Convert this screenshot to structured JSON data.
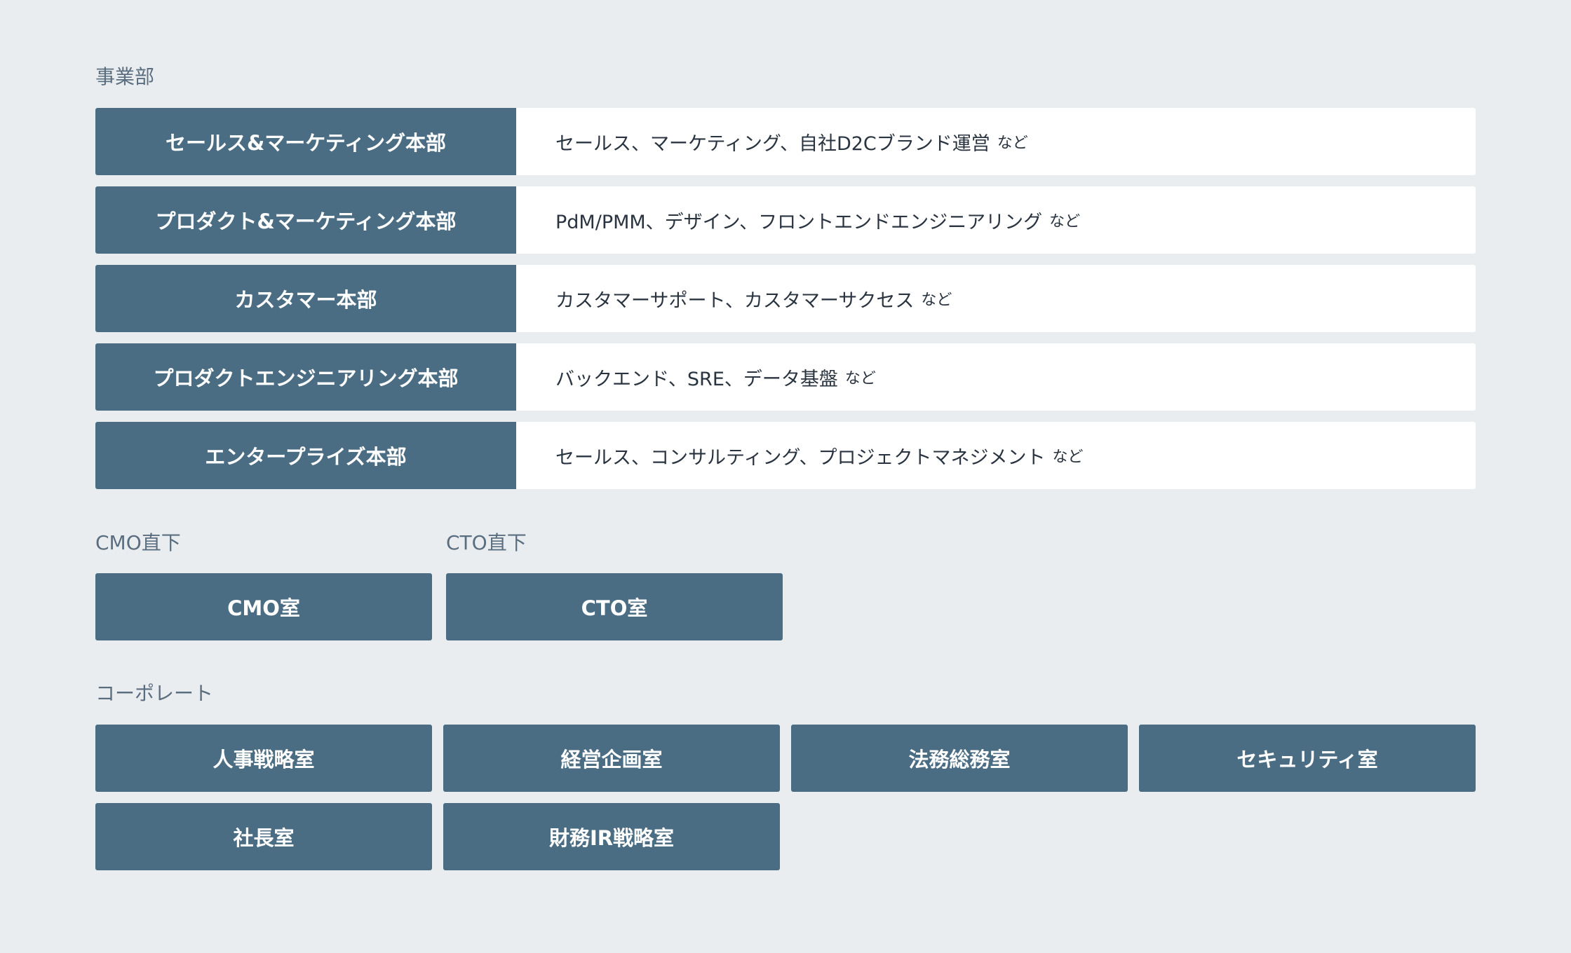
{
  "business": {
    "heading": "事業部",
    "rows": [
      {
        "name": "セールス&マーケティング本部",
        "desc": "セールス、マーケティング、自社D2Cブランド運営",
        "suffix": "など"
      },
      {
        "name": "プロダクト&マーケティング本部",
        "desc": "PdM/PMM、デザイン、フロントエンドエンジニアリング",
        "suffix": "など"
      },
      {
        "name": "カスタマー本部",
        "desc": "カスタマーサポート、カスタマーサクセス",
        "suffix": "など"
      },
      {
        "name": "プロダクトエンジニアリング本部",
        "desc": "バックエンド、SRE、データ基盤",
        "suffix": "など"
      },
      {
        "name": "エンタープライズ本部",
        "desc": "セールス、コンサルティング、プロジェクトマネジメント",
        "suffix": "など"
      }
    ]
  },
  "cmo": {
    "heading": "CMO直下",
    "box": "CMO室"
  },
  "cto": {
    "heading": "CTO直下",
    "box": "CTO室"
  },
  "corporate": {
    "heading": "コーポレート",
    "boxes": [
      "人事戦略室",
      "経営企画室",
      "法務総務室",
      "セキュリティ室",
      "社長室",
      "財務IR戦略室"
    ]
  },
  "colors": {
    "background": "#e9edf0",
    "block": "#4b6d84",
    "label": "#5b6e80"
  }
}
